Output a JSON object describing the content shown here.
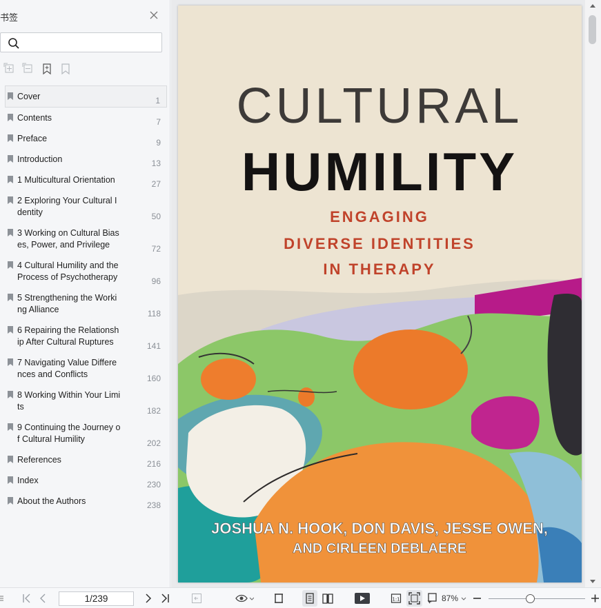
{
  "sidebar": {
    "title": "书签",
    "search_placeholder": "",
    "items": [
      {
        "label": "Cover",
        "page": "1",
        "selected": true
      },
      {
        "label": "Contents",
        "page": "7"
      },
      {
        "label": "Preface",
        "page": "9"
      },
      {
        "label": "Introduction",
        "page": "13"
      },
      {
        "label": "1 Multicultural Orientation",
        "page": "27"
      },
      {
        "label": "2 Exploring Your Cultural Identity",
        "page": "50"
      },
      {
        "label": "3 Working on Cultural Biases, Power, and Privilege",
        "page": "72"
      },
      {
        "label": "4 Cultural Humility and the Process of Psychotherapy",
        "page": "96"
      },
      {
        "label": "5 Strengthening the Working Alliance",
        "page": "118"
      },
      {
        "label": "6 Repairing the Relationship After Cultural Ruptures",
        "page": "141"
      },
      {
        "label": "7 Navigating Value Differences and Conflicts",
        "page": "160"
      },
      {
        "label": "8 Working Within Your Limits",
        "page": "182"
      },
      {
        "label": "9 Continuing the Journey of Cultural Humility",
        "page": "202"
      },
      {
        "label": "References",
        "page": "216"
      },
      {
        "label": "Index",
        "page": "230"
      },
      {
        "label": "About the Authors",
        "page": "238"
      }
    ]
  },
  "cover": {
    "title_line1": "CULTURAL",
    "title_line2": "HUMILITY",
    "subtitle_line1": "ENGAGING",
    "subtitle_line2": "DIVERSE IDENTITIES",
    "subtitle_line3": "IN THERAPY",
    "authors_line1": "JOSHUA N. HOOK, DON DAVIS, JESSE OWEN,",
    "authors_line2": "AND CIRLEEN DEBLAERE"
  },
  "toolbar": {
    "page_field": "1/239",
    "zoom": "87%"
  },
  "colors": {
    "accent": "#3b7ddd",
    "cover_bg": "#ede4d2",
    "title_dark": "#3d3a38",
    "subtitle_red": "#c0432b",
    "orange": "#ec7a2a",
    "magenta": "#b8218f"
  }
}
